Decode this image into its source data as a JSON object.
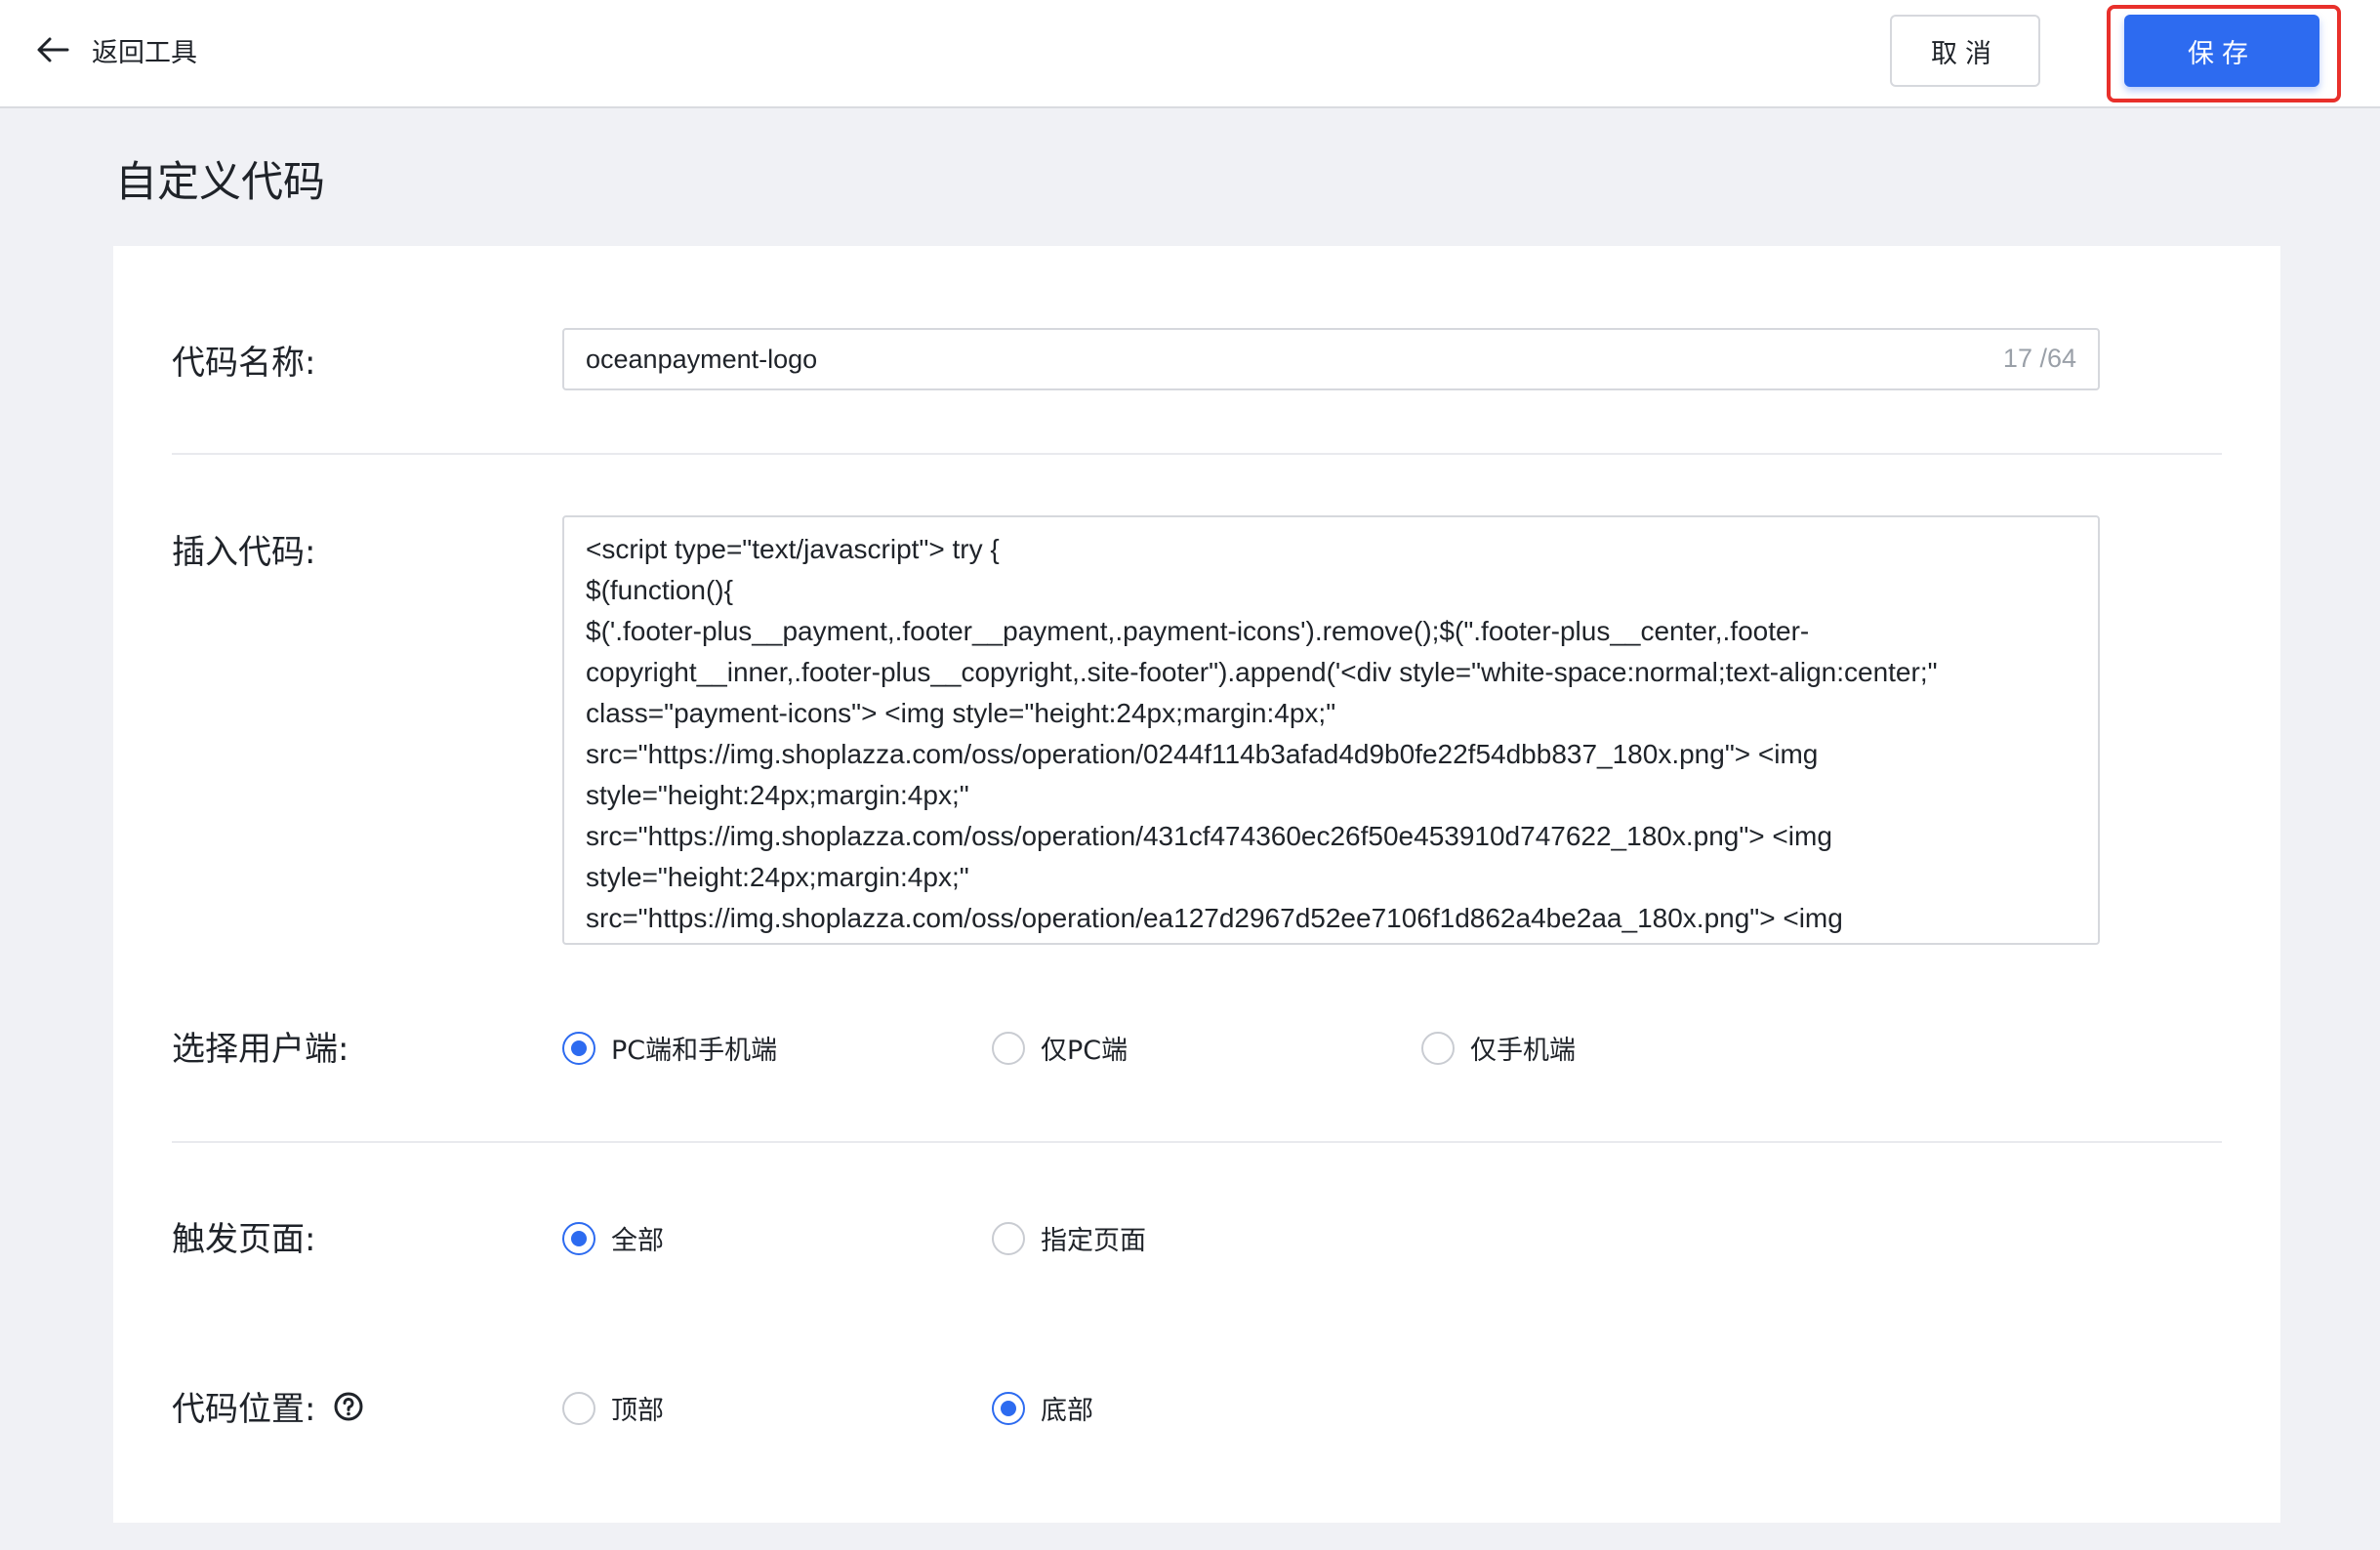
{
  "header": {
    "back_label": "返回工具",
    "cancel_label": "取消",
    "save_label": "保存",
    "accent_color": "#2d6bf0",
    "highlight_color": "#e8302b"
  },
  "page": {
    "title": "自定义代码"
  },
  "form": {
    "code_name": {
      "label": "代码名称:",
      "value": "oceanpayment-logo",
      "counter": "17 /64"
    },
    "insert_code": {
      "label": "插入代码:",
      "lines": [
        "<script type=\"text/javascript\"> try {",
        "$(function(){",
        "$('.footer-plus__payment,.footer__payment,.payment-icons').remove();$(\".footer-plus__center,.footer-",
        "copyright__inner,.footer-plus__copyright,.site-footer\").append('<div style=\"white-space:normal;text-align:center;\"",
        "class=\"payment-icons\"> <img style=\"height:24px;margin:4px;\"",
        "src=\"https://img.shoplazza.com/oss/operation/0244f114b3afad4d9b0fe22f54dbb837_180x.png\"> <img",
        "style=\"height:24px;margin:4px;\"",
        "src=\"https://img.shoplazza.com/oss/operation/431cf474360ec26f50e453910d747622_180x.png\"> <img",
        "style=\"height:24px;margin:4px;\"",
        "src=\"https://img.shoplazza.com/oss/operation/ea127d2967d52ee7106f1d862a4be2aa_180x.png\"> <img"
      ]
    },
    "client": {
      "label": "选择用户端:",
      "options": [
        "PC端和手机端",
        "仅PC端",
        "仅手机端"
      ],
      "selected": "PC端和手机端"
    },
    "trigger_page": {
      "label": "触发页面:",
      "options": [
        "全部",
        "指定页面"
      ],
      "selected": "全部"
    },
    "position": {
      "label": "代码位置:",
      "options": [
        "顶部",
        "底部"
      ],
      "selected": "底部",
      "help_icon": "question-circle-icon"
    }
  }
}
